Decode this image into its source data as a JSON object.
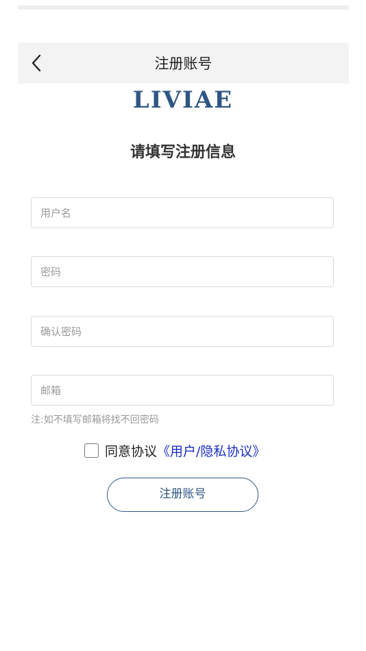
{
  "header": {
    "title": "注册账号"
  },
  "logo": {
    "text": "LIVIAE",
    "color": "#2f5683"
  },
  "form": {
    "heading": "请填写注册信息",
    "username_placeholder": "用户名",
    "password_placeholder": "密码",
    "confirm_password_placeholder": "确认密码",
    "email_placeholder": "邮箱",
    "note": "注:如不填写邮箱将找不回密码",
    "agree_text": "同意协议",
    "agreement_link": "《用户/隐私协议》",
    "agree_checked": false,
    "submit_label": "注册账号"
  },
  "icons": {
    "back": "chevron-left-icon"
  },
  "colors": {
    "accent": "#2f5683",
    "link": "#1a2fc7",
    "header_bg": "#f3f3f3"
  }
}
